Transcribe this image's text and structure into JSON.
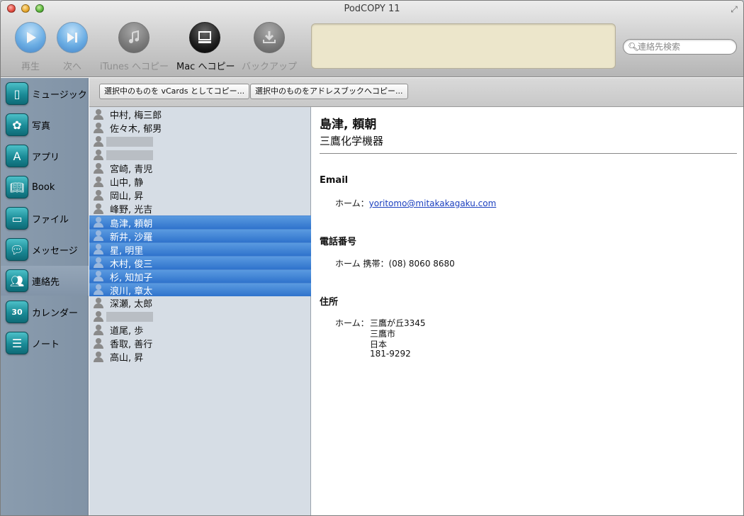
{
  "window": {
    "title": "PodCOPY 11"
  },
  "toolbar": {
    "play_label": "再生",
    "next_label": "次へ",
    "itunes_label": "iTunes へコピー",
    "mac_label": "Mac へコピー",
    "backup_label": "バックアップ"
  },
  "search": {
    "placeholder": "連絡先検索",
    "value": ""
  },
  "sidebar": {
    "items": [
      {
        "label": "ミュージック",
        "icon": "ipod-icon"
      },
      {
        "label": "写真",
        "icon": "flower-icon"
      },
      {
        "label": "アプリ",
        "icon": "app-store-icon"
      },
      {
        "label": "Book",
        "icon": "book-icon"
      },
      {
        "label": "ファイル",
        "icon": "folder-icon"
      },
      {
        "label": "メッセージ",
        "icon": "speech-bubble-icon"
      },
      {
        "label": "連絡先",
        "icon": "contacts-icon",
        "selected": true
      },
      {
        "label": "カレンダー",
        "icon": "calendar-icon",
        "badge": "30"
      },
      {
        "label": "ノート",
        "icon": "notepad-icon"
      }
    ]
  },
  "actions": {
    "vcards_label": "選択中のものを vCards としてコピー...",
    "addressbook_label": "選択中のものをアドレスブックへコピー..."
  },
  "contacts": [
    {
      "name": "中村, 梅三郎"
    },
    {
      "name": "佐々木, 郁男"
    },
    {
      "name": "",
      "redacted": true
    },
    {
      "name": "",
      "redacted": true
    },
    {
      "name": "宮崎, 青児"
    },
    {
      "name": "山中, 静"
    },
    {
      "name": "岡山, 昇"
    },
    {
      "name": "峰野, 光吉"
    },
    {
      "name": "島津, 頼朝",
      "selected": true
    },
    {
      "name": "新井, 沙羅",
      "selected": true
    },
    {
      "name": "星, 明里",
      "selected": true
    },
    {
      "name": "木村, 俊三",
      "selected": true
    },
    {
      "name": "杉, 知加子",
      "selected": true
    },
    {
      "name": "浪川, 章太",
      "selected": true
    },
    {
      "name": "深瀬, 太郎"
    },
    {
      "name": "",
      "redacted": true
    },
    {
      "name": "道尾, 歩"
    },
    {
      "name": "香取, 善行"
    },
    {
      "name": "高山, 昇"
    }
  ],
  "detail": {
    "name": "島津, 頼朝",
    "company": "三鷹化学機器",
    "email_heading": "Email",
    "email_label": "ホーム：",
    "email_value": "yoritomo@mitakakagaku.com",
    "phone_heading": "電話番号",
    "phone_label": "ホーム 携帯：",
    "phone_value": "(08) 8060 8680",
    "address_heading": "住所",
    "address_label": "ホーム：",
    "address_lines": [
      "三鷹が丘3345",
      "三鷹市",
      "日本",
      "181-9292"
    ]
  },
  "colors": {
    "selection": "#2f73cc",
    "sidebar_bg": "#8193a6",
    "status_box": "#ece6cb",
    "link": "#1a3fbf"
  }
}
